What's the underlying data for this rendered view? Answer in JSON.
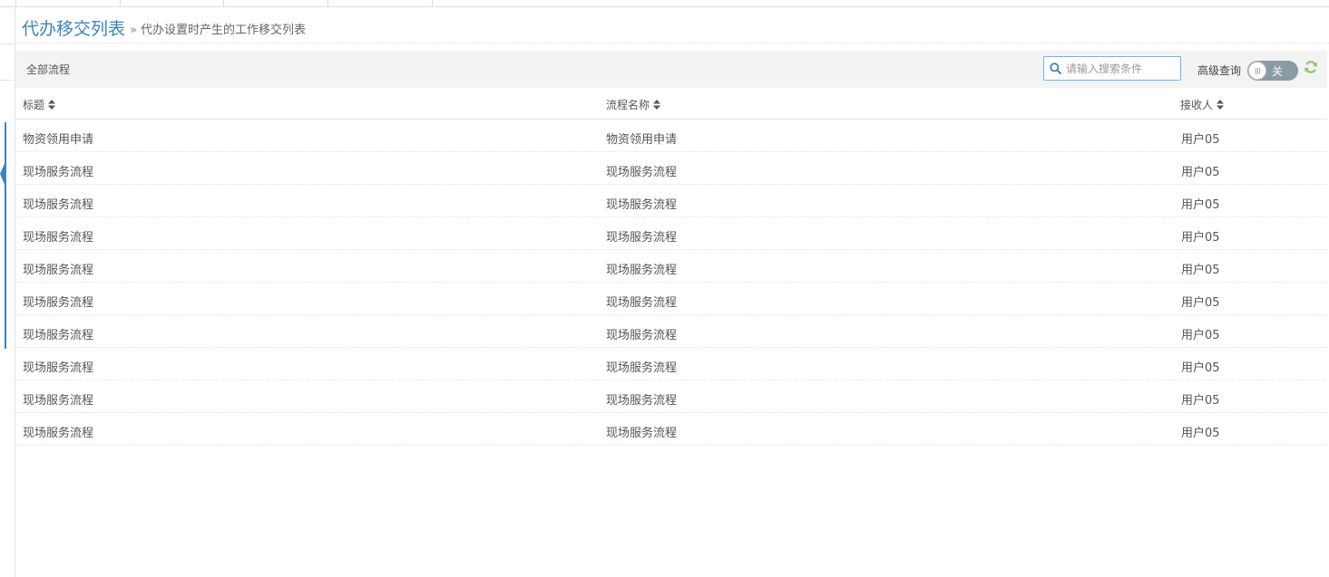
{
  "header": {
    "title": "代办移交列表",
    "subtitle_prefix": "»",
    "subtitle": "代办设置时产生的工作移交列表"
  },
  "toolbar": {
    "title": "全部流程",
    "search_placeholder": "请输入搜索条件",
    "search_value": "",
    "advanced_label": "高级查询",
    "toggle_label": "关",
    "toggle_on": false
  },
  "icons": {
    "search": "search-icon",
    "refresh": "refresh-icon",
    "sort": "sort-icon"
  },
  "colors": {
    "accent": "#3b84c4",
    "refresh": "#8cc474",
    "toggle_off": "#8b9aa3",
    "search_border": "#6fb3e0"
  },
  "table": {
    "columns": [
      "标题",
      "流程名称",
      "接收人"
    ],
    "rows": [
      [
        "物资领用申请",
        "物资领用申请",
        "用户05"
      ],
      [
        "现场服务流程",
        "现场服务流程",
        "用户05"
      ],
      [
        "现场服务流程",
        "现场服务流程",
        "用户05"
      ],
      [
        "现场服务流程",
        "现场服务流程",
        "用户05"
      ],
      [
        "现场服务流程",
        "现场服务流程",
        "用户05"
      ],
      [
        "现场服务流程",
        "现场服务流程",
        "用户05"
      ],
      [
        "现场服务流程",
        "现场服务流程",
        "用户05"
      ],
      [
        "现场服务流程",
        "现场服务流程",
        "用户05"
      ],
      [
        "现场服务流程",
        "现场服务流程",
        "用户05"
      ],
      [
        "现场服务流程",
        "现场服务流程",
        "用户05"
      ]
    ]
  }
}
